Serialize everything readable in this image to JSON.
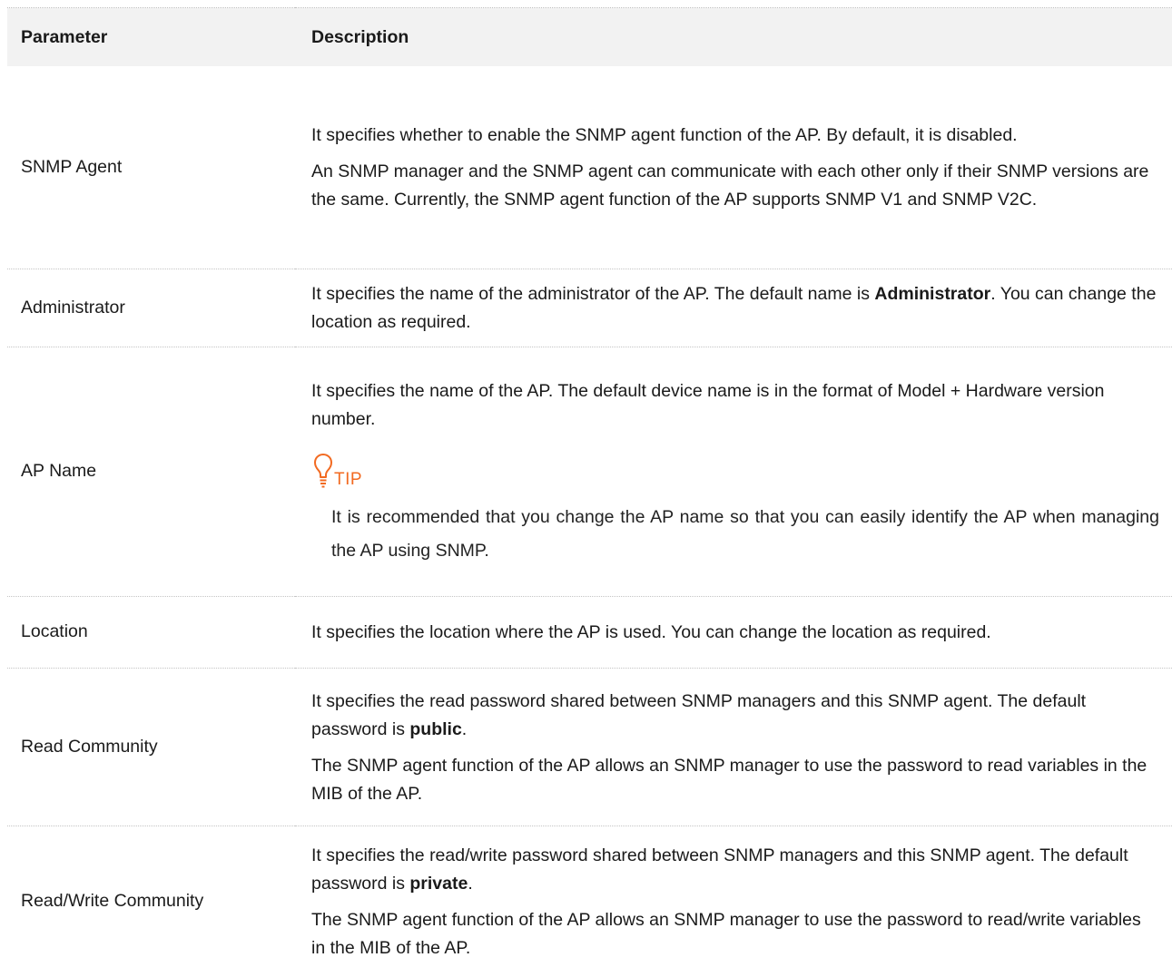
{
  "table": {
    "headers": {
      "parameter": "Parameter",
      "description": "Description"
    },
    "rows": [
      {
        "name": "SNMP Agent",
        "paragraphs": [
          {
            "text": "It specifies whether to enable the SNMP agent function of the AP. By default, it is disabled."
          },
          {
            "text": "An SNMP manager and the SNMP agent can communicate with each other only if their SNMP versions are the same. Currently, the SNMP agent function of the AP supports SNMP V1 and SNMP V2C."
          }
        ]
      },
      {
        "name": "Administrator",
        "paragraphs": [
          {
            "pre": "It specifies the name of the administrator of the AP. The default name is ",
            "bold": "Administrator",
            "post": ". You can change the location as required."
          }
        ]
      },
      {
        "name": "AP Name",
        "paragraphs": [
          {
            "text": "It specifies the name of the AP. The default device name is in the format of Model + Hardware version number."
          }
        ],
        "tip": {
          "icon": "lightbulb-icon",
          "label": "TIP",
          "text": "It is recommended that you change the AP name so that you can easily identify the AP when managing the AP using SNMP."
        }
      },
      {
        "name": "Location",
        "paragraphs": [
          {
            "text": "It specifies the location where the AP is used. You can change the location as required."
          }
        ]
      },
      {
        "name": "Read Community",
        "paragraphs": [
          {
            "pre": "It specifies the read password shared between SNMP managers and this SNMP agent. The default password is ",
            "bold": "public",
            "post": "."
          },
          {
            "text": "The SNMP agent function of the AP allows an SNMP manager to use the password to read variables in the MIB of the AP."
          }
        ]
      },
      {
        "name": "Read/Write Community",
        "paragraphs": [
          {
            "pre": "It specifies the read/write password shared between SNMP managers and this SNMP agent. The default password is ",
            "bold": "private",
            "post": "."
          },
          {
            "text": "The SNMP agent function of the AP allows an SNMP manager to use the password to read/write variables in the MIB of the AP."
          }
        ]
      }
    ]
  },
  "colors": {
    "tip_accent": "#f26a21",
    "header_bg": "#f2f2f2"
  }
}
